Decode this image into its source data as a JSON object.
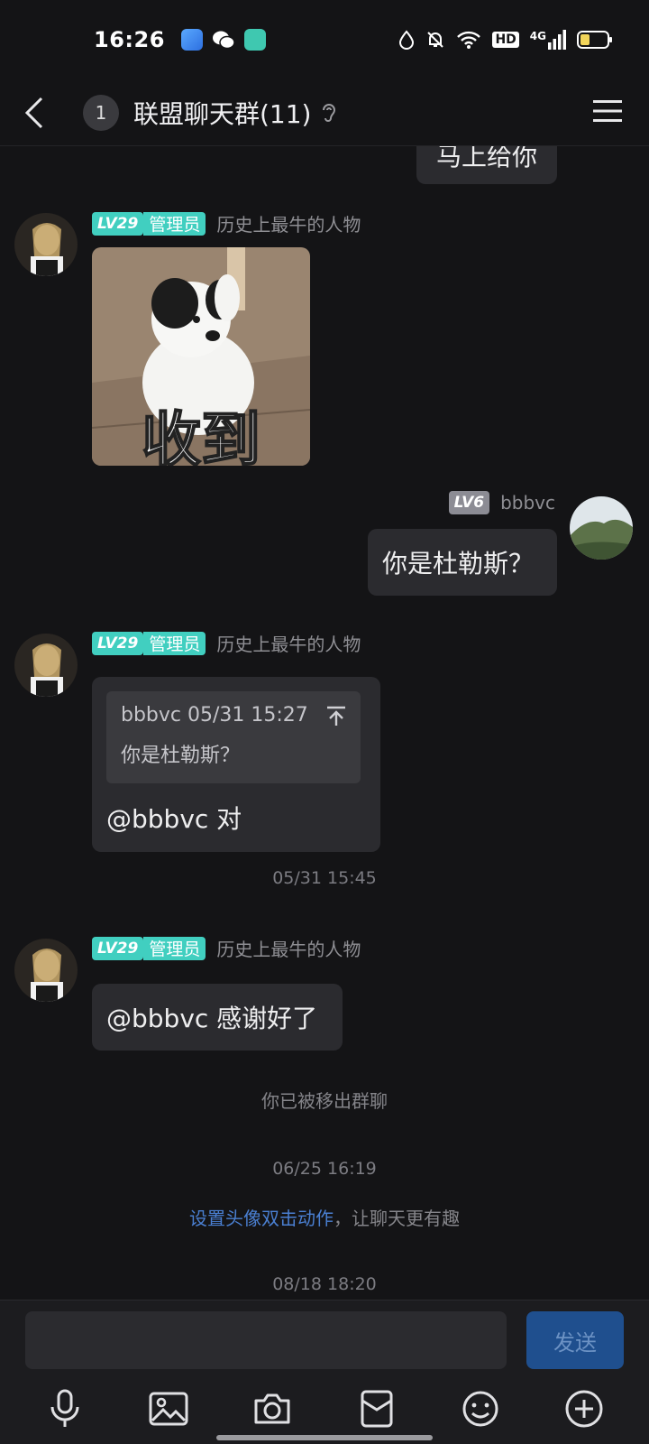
{
  "status": {
    "time": "16:26",
    "network": "4G",
    "hd_label": "HD"
  },
  "header": {
    "unread_count": "1",
    "title": "联盟聊天群(11)"
  },
  "messages": {
    "partial_bubble_text": "马上给你",
    "m1": {
      "level": "LV29",
      "role": "管理员",
      "title": "历史上最牛的人物",
      "sticker_caption": "收到"
    },
    "m2": {
      "level": "LV6",
      "sender": "bbbvc",
      "text": "你是杜勒斯？"
    },
    "m3": {
      "level": "LV29",
      "role": "管理员",
      "title": "历史上最牛的人物",
      "quote_meta": "bbbvc 05/31 15:27",
      "quote_text": "你是杜勒斯？",
      "text": "@bbbvc 对"
    },
    "time1": "05/31 15:45",
    "m4": {
      "level": "LV29",
      "role": "管理员",
      "title": "历史上最牛的人物",
      "text": "@bbbvc 感谢好了"
    },
    "system_removed": "你已被移出群聊",
    "time2": "06/25 16:19",
    "tip_link": "设置头像双击动作",
    "tip_rest": "，让聊天更有趣",
    "time3": "08/18 18:20"
  },
  "input": {
    "placeholder": "",
    "send_label": "发送"
  },
  "colors": {
    "background": "#141416",
    "bubble": "#2b2b2f",
    "level_badge": "#41cfc0",
    "send_button": "#1f4f8e",
    "link": "#4a7fd1"
  }
}
